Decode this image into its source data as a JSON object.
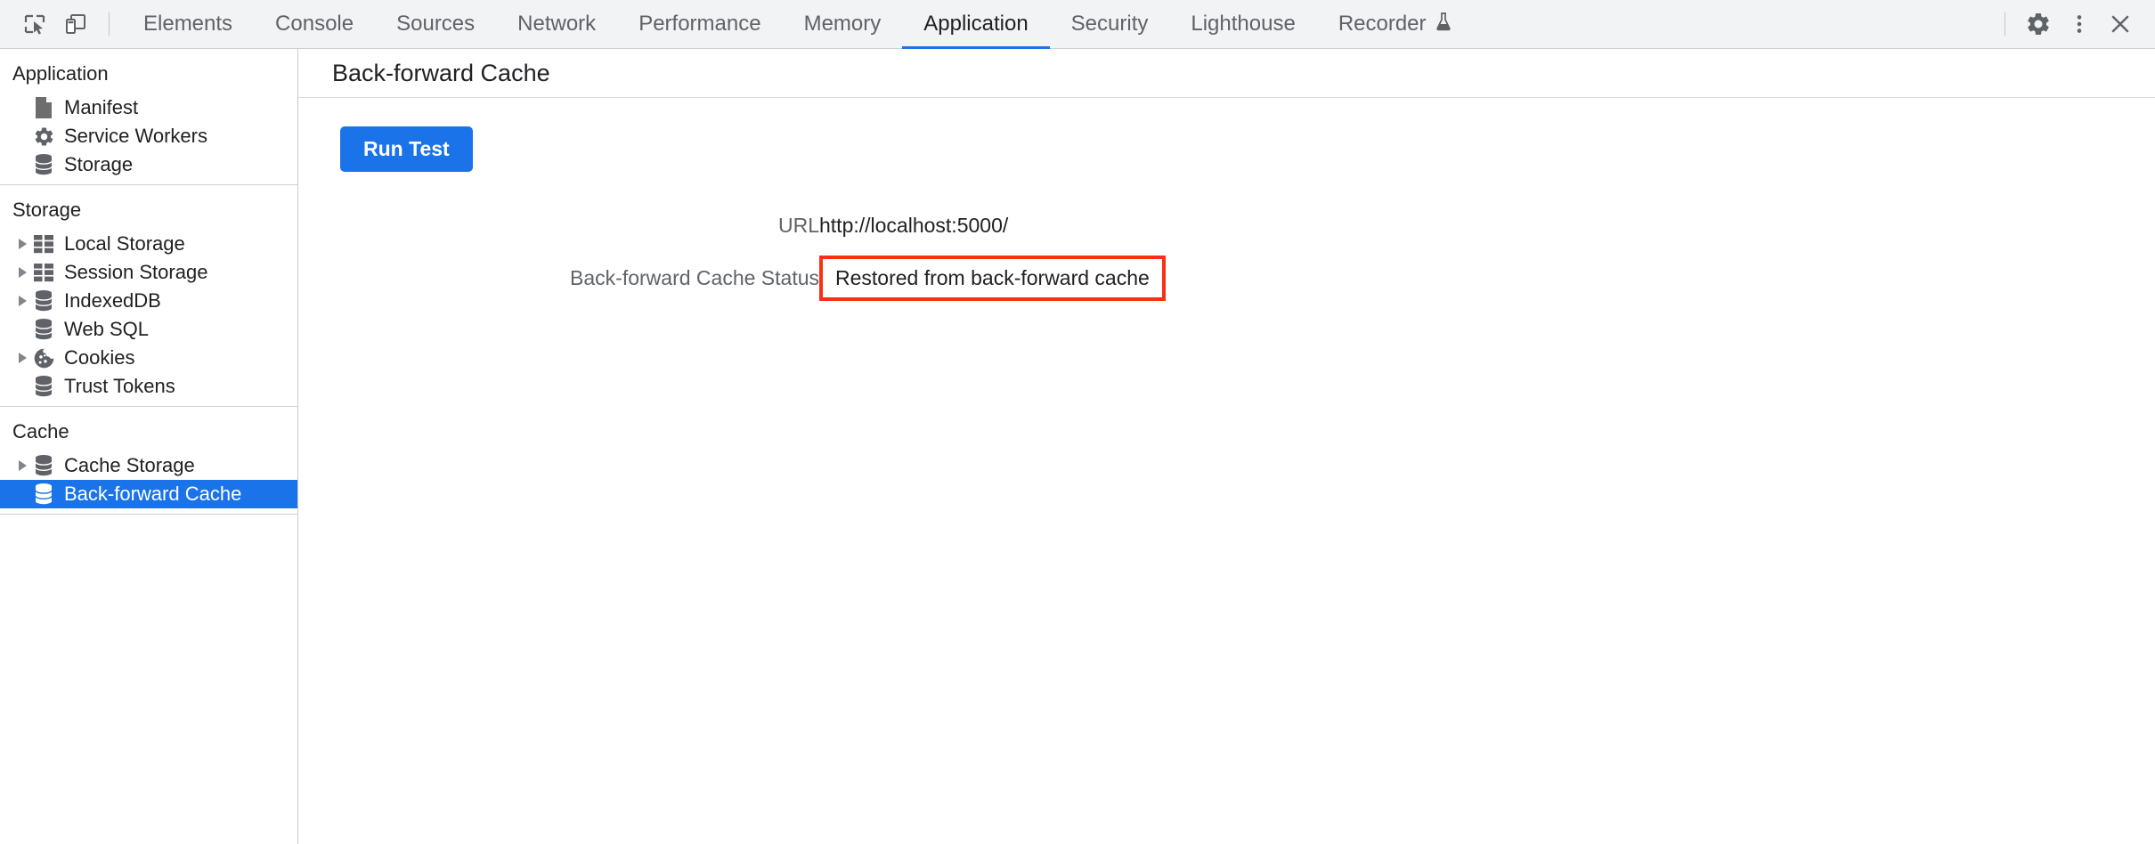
{
  "toolbar": {
    "icons": [
      {
        "name": "inspect-element-icon",
        "title": "Inspect element"
      },
      {
        "name": "device-toolbar-icon",
        "title": "Toggle device toolbar"
      }
    ],
    "tabs": [
      {
        "label": "Elements",
        "active": false
      },
      {
        "label": "Console",
        "active": false
      },
      {
        "label": "Sources",
        "active": false
      },
      {
        "label": "Network",
        "active": false
      },
      {
        "label": "Performance",
        "active": false
      },
      {
        "label": "Memory",
        "active": false
      },
      {
        "label": "Application",
        "active": true
      },
      {
        "label": "Security",
        "active": false
      },
      {
        "label": "Lighthouse",
        "active": false
      },
      {
        "label": "Recorder",
        "active": false,
        "badge_icon": "experiment-flask-icon"
      }
    ],
    "actions": [
      {
        "name": "settings-gear-icon",
        "label": "Settings"
      },
      {
        "name": "more-options-icon",
        "label": "More options"
      },
      {
        "name": "close-devtools-icon",
        "label": "Close"
      }
    ]
  },
  "sidebar": {
    "sections": [
      {
        "title": "Application",
        "items": [
          {
            "label": "Manifest",
            "icon": "manifest-document-icon",
            "expandable": false,
            "selected": false
          },
          {
            "label": "Service Workers",
            "icon": "gear-icon",
            "expandable": false,
            "selected": false
          },
          {
            "label": "Storage",
            "icon": "database-icon",
            "expandable": false,
            "selected": false
          }
        ]
      },
      {
        "title": "Storage",
        "items": [
          {
            "label": "Local Storage",
            "icon": "table-grid-icon",
            "expandable": true,
            "selected": false
          },
          {
            "label": "Session Storage",
            "icon": "table-grid-icon",
            "expandable": true,
            "selected": false
          },
          {
            "label": "IndexedDB",
            "icon": "database-icon",
            "expandable": true,
            "selected": false
          },
          {
            "label": "Web SQL",
            "icon": "database-icon",
            "expandable": false,
            "selected": false
          },
          {
            "label": "Cookies",
            "icon": "cookie-icon",
            "expandable": true,
            "selected": false
          },
          {
            "label": "Trust Tokens",
            "icon": "database-icon",
            "expandable": false,
            "selected": false
          }
        ]
      },
      {
        "title": "Cache",
        "items": [
          {
            "label": "Cache Storage",
            "icon": "database-icon",
            "expandable": true,
            "selected": false
          },
          {
            "label": "Back-forward Cache",
            "icon": "database-icon",
            "expandable": false,
            "selected": true
          }
        ]
      }
    ]
  },
  "main": {
    "title": "Back-forward Cache",
    "run_test_label": "Run Test",
    "report": {
      "url_key": "URL",
      "url_value": "http://localhost:5000/",
      "status_key": "Back-forward Cache Status",
      "status_value": "Restored from back-forward cache"
    }
  },
  "colors": {
    "accent_blue": "#1a73e8",
    "toolbar_bg": "#f1f3f4",
    "highlight_red": "#fa2f14",
    "icon_gray": "#5f6368",
    "text_primary": "#202124",
    "text_secondary": "#5f6368"
  }
}
